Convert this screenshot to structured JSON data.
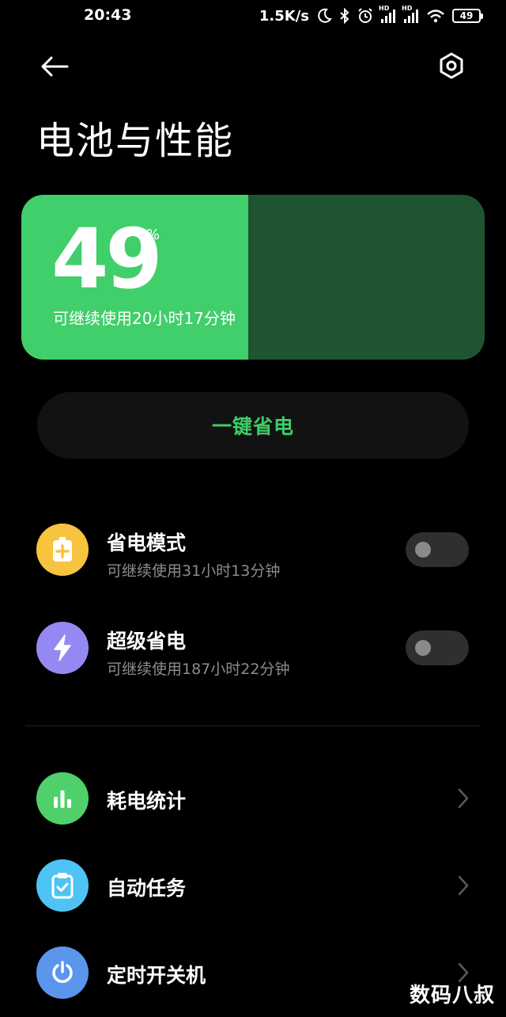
{
  "status_bar": {
    "time": "20:43",
    "net_speed": "1.5K/s",
    "hd_label_1": "HD",
    "hd_label_2": "HD",
    "battery_level": "49",
    "icons": [
      "moon-icon",
      "bluetooth-icon",
      "alarm-icon",
      "signal-icon",
      "signal-icon",
      "wifi-icon",
      "battery-icon"
    ]
  },
  "header": {
    "back_icon": "arrow-left-icon",
    "settings_icon": "gear-icon",
    "title": "电池与性能"
  },
  "battery": {
    "level_percent": 49,
    "percent_value": "49",
    "percent_unit": "%",
    "remaining": "可继续使用20小时17分钟",
    "fill_color": "#40cf6a",
    "empty_color": "#1e5530"
  },
  "one_tap": {
    "label": "一键省电",
    "color": "#3fcc68"
  },
  "power_modes": [
    {
      "title": "省电模式",
      "subtitle": "可继续使用31小时13分钟",
      "icon": "battery-plus-icon",
      "icon_color": "#f8c33f",
      "enabled": false
    },
    {
      "title": "超级省电",
      "subtitle": "可继续使用187小时22分钟",
      "icon": "lightning-icon",
      "icon_color": "#9489f3",
      "enabled": false
    }
  ],
  "menu": [
    {
      "title": "耗电统计",
      "icon": "bar-chart-icon",
      "icon_color": "#4fd06a"
    },
    {
      "title": "自动任务",
      "icon": "clipboard-check-icon",
      "icon_color": "#4ec4f4"
    },
    {
      "title": "定时开关机",
      "icon": "power-icon",
      "icon_color": "#5b95ec"
    }
  ],
  "watermark": "数码八叔"
}
